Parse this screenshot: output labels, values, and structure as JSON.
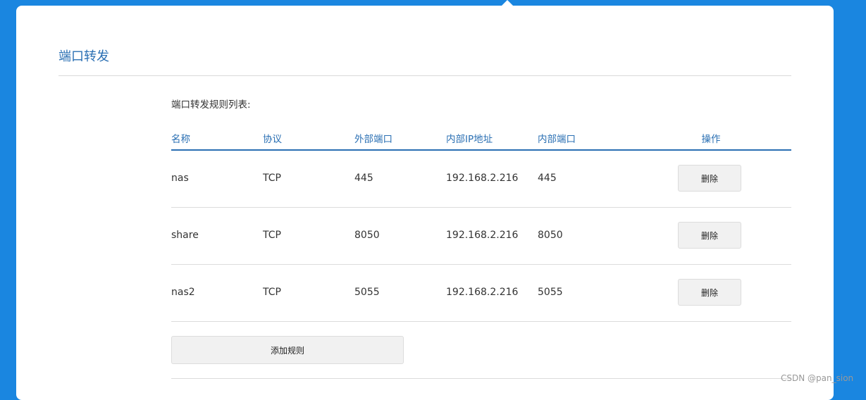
{
  "page": {
    "title": "端口转发",
    "list_caption": "端口转发规则列表:"
  },
  "table": {
    "headers": {
      "name": "名称",
      "protocol": "协议",
      "external_port": "外部端口",
      "internal_ip": "内部IP地址",
      "internal_port": "内部端口",
      "operation": "操作"
    },
    "rows": [
      {
        "name": "nas",
        "protocol": "TCP",
        "external_port": "445",
        "internal_ip": "192.168.2.216",
        "internal_port": "445",
        "delete_label": "删除"
      },
      {
        "name": "share",
        "protocol": "TCP",
        "external_port": "8050",
        "internal_ip": "192.168.2.216",
        "internal_port": "8050",
        "delete_label": "删除"
      },
      {
        "name": "nas2",
        "protocol": "TCP",
        "external_port": "5055",
        "internal_ip": "192.168.2.216",
        "internal_port": "5055",
        "delete_label": "删除"
      }
    ]
  },
  "add_rule_label": "添加规则",
  "watermark": "CSDN @pan_sion",
  "colors": {
    "background": "#1a86e0",
    "accent": "#2a6fb3"
  }
}
